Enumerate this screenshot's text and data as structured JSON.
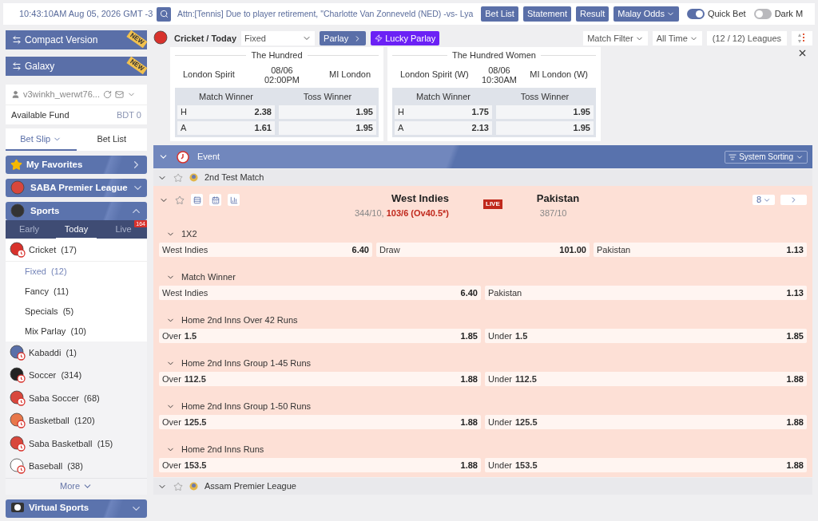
{
  "top_bar": {
    "clock": "10:43:10AM Aug 05, 2026 GMT -3",
    "notice": "Attn:[Tennis] Due to player retirement, \"Charlotte Van Zonneveld (NED) -vs- Lya",
    "buttons": [
      "Bet List",
      "Statement",
      "Result"
    ],
    "odds_dropdown": "Malay Odds",
    "toggles": [
      {
        "label": "Quick Bet",
        "on": true
      },
      {
        "label": "Dark M",
        "on": false
      }
    ]
  },
  "sidebar": {
    "banners": [
      {
        "label": "Compact Version",
        "badge": "NEW"
      },
      {
        "label": "Galaxy",
        "badge": "NEW"
      }
    ],
    "account": {
      "username": "v3winkh_werwt76...",
      "fund_label": "Available Fund",
      "fund_value": "BDT 0"
    },
    "slip_tabs": [
      {
        "label": "Bet Slip",
        "selected": true
      },
      {
        "label": "Bet List",
        "selected": false
      }
    ],
    "sections_top": [
      {
        "label": "My Favorites",
        "expanded": false,
        "kind": "favorites"
      },
      {
        "label": "SABA Premier League",
        "expanded": false,
        "kind": "league"
      },
      {
        "label": "Sports",
        "expanded": true,
        "kind": "sports"
      }
    ],
    "period_tabs": [
      {
        "label": "Early",
        "selected": false
      },
      {
        "label": "Today",
        "selected": true
      },
      {
        "label": "Live",
        "selected": false,
        "badge": "164"
      }
    ],
    "sports": [
      {
        "label": "Cricket",
        "count": "(17)",
        "color": "#d8322c",
        "expanded": true,
        "children": [
          {
            "label": "Fixed",
            "count": "(12)",
            "selected": true
          },
          {
            "label": "Fancy",
            "count": "(11)",
            "selected": false
          },
          {
            "label": "Specials",
            "count": "(5)",
            "selected": false
          },
          {
            "label": "Mix Parlay",
            "count": "(10)",
            "selected": false
          }
        ]
      },
      {
        "label": "Kabaddi",
        "count": "(1)",
        "color": "#5a6fa8",
        "expanded": false
      },
      {
        "label": "Soccer",
        "count": "(314)",
        "color": "#222222",
        "expanded": false
      },
      {
        "label": "Saba Soccer",
        "count": "(68)",
        "color": "#d8473c",
        "expanded": false
      },
      {
        "label": "Basketball",
        "count": "(120)",
        "color": "#e8774a",
        "expanded": false
      },
      {
        "label": "Saba Basketball",
        "count": "(15)",
        "color": "#d8473c",
        "expanded": false
      },
      {
        "label": "Baseball",
        "count": "(38)",
        "color": "#ffffff",
        "expanded": false
      }
    ],
    "more": "More",
    "sections_bottom": [
      {
        "label": "Virtual Sports",
        "expanded": false,
        "kind": "virtual"
      }
    ]
  },
  "main": {
    "breadcrumb": "Cricket / Today",
    "market_select": "Fixed",
    "parlay": "Parlay",
    "lucky_parlay": "Lucky Parlay",
    "filters": [
      "Match Filter",
      "All Time"
    ],
    "leagues_count": "(12 / 12) Leagues",
    "featured": [
      {
        "league": "The Hundred",
        "home": "London Spirit",
        "away": "MI London",
        "date": "08/06",
        "time": "02:00PM",
        "columns": [
          "Match Winner",
          "Toss Winner"
        ],
        "rows": [
          {
            "side": "H",
            "odds": [
              "2.38",
              "1.95"
            ]
          },
          {
            "side": "A",
            "odds": [
              "1.61",
              "1.95"
            ]
          }
        ]
      },
      {
        "league": "The Hundred Women",
        "home": "London Spirit (W)",
        "away": "MI London (W)",
        "date": "08/06",
        "time": "10:30AM",
        "columns": [
          "Match Winner",
          "Toss Winner"
        ],
        "rows": [
          {
            "side": "H",
            "odds": [
              "1.75",
              "1.95"
            ]
          },
          {
            "side": "A",
            "odds": [
              "2.13",
              "1.95"
            ]
          }
        ]
      }
    ],
    "event_header": "Event",
    "sorting": "System Sorting",
    "leagues": [
      {
        "name": "2nd Test Match",
        "match": {
          "home": "West Indies",
          "away": "Pakistan",
          "home_score": "344/10,",
          "home_live": "103/6 (Ov40.5*)",
          "away_score": "387/10",
          "status": "LIVE",
          "more_count": "8",
          "markets": [
            {
              "title": "1X2",
              "selections": [
                {
                  "label": "West Indies",
                  "odds": "6.40"
                },
                {
                  "label": "Draw",
                  "odds": "101.00"
                },
                {
                  "label": "Pakistan",
                  "odds": "1.13"
                }
              ]
            },
            {
              "title": "Match Winner",
              "selections": [
                {
                  "label": "West Indies",
                  "odds": "6.40"
                },
                {
                  "label": "Pakistan",
                  "odds": "1.13"
                }
              ]
            },
            {
              "title": "Home 2nd Inns Over 42 Runs",
              "selections": [
                {
                  "label": "Over",
                  "line": "1.5",
                  "odds": "1.85"
                },
                {
                  "label": "Under",
                  "line": "1.5",
                  "odds": "1.85"
                }
              ]
            },
            {
              "title": "Home 2nd Inns Group 1-45 Runs",
              "selections": [
                {
                  "label": "Over",
                  "line": "112.5",
                  "odds": "1.88"
                },
                {
                  "label": "Under",
                  "line": "112.5",
                  "odds": "1.88"
                }
              ]
            },
            {
              "title": "Home 2nd Inns Group 1-50 Runs",
              "selections": [
                {
                  "label": "Over",
                  "line": "125.5",
                  "odds": "1.88"
                },
                {
                  "label": "Under",
                  "line": "125.5",
                  "odds": "1.88"
                }
              ]
            },
            {
              "title": "Home 2nd Inns Runs",
              "selections": [
                {
                  "label": "Over",
                  "line": "153.5",
                  "odds": "1.88"
                },
                {
                  "label": "Under",
                  "line": "153.5",
                  "odds": "1.88"
                }
              ]
            }
          ]
        }
      },
      {
        "name": "Assam Premier League"
      }
    ]
  }
}
